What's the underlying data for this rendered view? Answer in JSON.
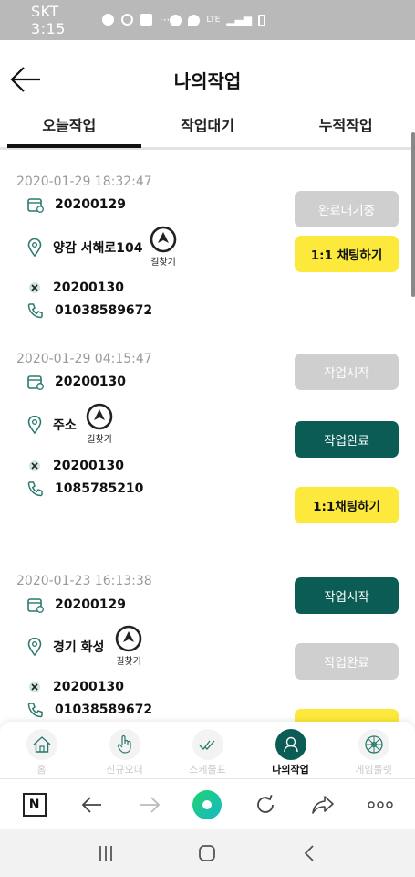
{
  "status_bar": {
    "carrier_time": "SKT 3:15",
    "network": "LTE"
  },
  "header": {
    "title": "나의작업"
  },
  "tabs": [
    {
      "label": "오늘작업",
      "active": true
    },
    {
      "label": "작업대기",
      "active": false
    },
    {
      "label": "누적작업",
      "active": false
    }
  ],
  "jobs": [
    {
      "datetime": "2020-01-29 18:32:47",
      "date_value": "20200129",
      "address": "양감 서해로104",
      "nav_label": "길찾기",
      "due_value": "20200130",
      "phone": "01038589672",
      "buttons": [
        {
          "label": "완료대기중",
          "style": "gray"
        },
        {
          "label": "1:1 채팅하기",
          "style": "yellow"
        }
      ]
    },
    {
      "datetime": "2020-01-29 04:15:47",
      "date_value": "20200130",
      "address": "주소",
      "nav_label": "길찾기",
      "due_value": "20200130",
      "phone": "1085785210",
      "buttons": [
        {
          "label": "작업시작",
          "style": "gray"
        },
        {
          "label": "작업완료",
          "style": "teal"
        },
        {
          "label": "1:1채팅하기",
          "style": "yellow"
        }
      ]
    },
    {
      "datetime": "2020-01-23 16:13:38",
      "date_value": "20200129",
      "address": "경기 화성",
      "nav_label": "길찾기",
      "due_value": "20200130",
      "phone": "01038589672",
      "buttons": [
        {
          "label": "작업시작",
          "style": "teal"
        },
        {
          "label": "작업완료",
          "style": "gray"
        }
      ]
    }
  ],
  "bottom_nav": [
    {
      "label": "홈",
      "icon": "home-icon",
      "active": false
    },
    {
      "label": "신규오더",
      "icon": "hand-pointer-icon",
      "active": false
    },
    {
      "label": "스케줄표",
      "icon": "check-icon",
      "active": false
    },
    {
      "label": "나의작업",
      "icon": "person-icon",
      "active": true
    },
    {
      "label": "게임룰렛",
      "icon": "roulette-icon",
      "active": false
    }
  ],
  "browser_bar": {
    "naver_label": "N"
  },
  "colors": {
    "teal": "#0c5c56",
    "yellow": "#fde93b",
    "gray_button": "#cfcfcf"
  }
}
